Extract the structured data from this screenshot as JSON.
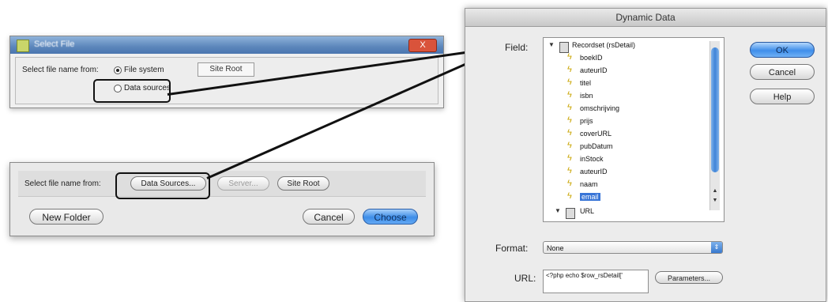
{
  "select_file": {
    "title": "Select File",
    "close_label": "X",
    "select_label": "Select file name from:",
    "radio_file_system": "File system",
    "radio_data_sources": "Data sources",
    "site_root_label": "Site Root",
    "bottom_select_label": "Select file name from:",
    "data_sources_button": "Data Sources...",
    "server_button": "Server...",
    "site_root_button": "Site Root",
    "new_folder_button": "New Folder",
    "cancel_button": "Cancel",
    "choose_button": "Choose"
  },
  "dynamic_data": {
    "title": "Dynamic Data",
    "field_label": "Field:",
    "tree_root": "Recordset (rsDetail)",
    "tree_items": [
      "boekID",
      "auteurID",
      "titel",
      "isbn",
      "omschrijving",
      "prijs",
      "coverURL",
      "pubDatum",
      "inStock",
      "auteurID",
      "naam",
      "email"
    ],
    "selected_item": "email",
    "tree_last": "URL",
    "ok_button": "OK",
    "cancel_button": "Cancel",
    "help_button": "Help",
    "format_label": "Format:",
    "format_value": "None",
    "url_label": "URL:",
    "url_value": "<?php echo $row_rsDetail['",
    "parameters_button": "Parameters..."
  },
  "colors": {
    "accent_blue": "#3f8eea",
    "selection": "#3875d7",
    "callout": "#111111"
  }
}
